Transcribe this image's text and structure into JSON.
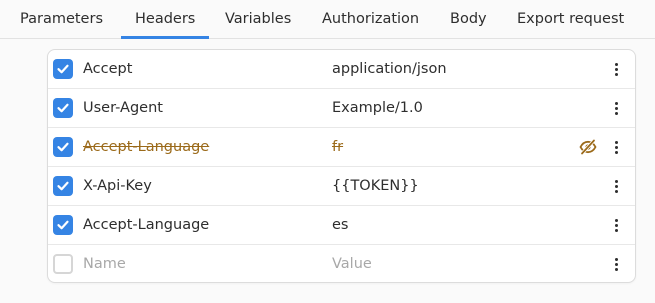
{
  "tabs": [
    {
      "label": "Parameters",
      "active": false
    },
    {
      "label": "Headers",
      "active": true
    },
    {
      "label": "Variables",
      "active": false
    },
    {
      "label": "Authorization",
      "active": false
    },
    {
      "label": "Body",
      "active": false
    },
    {
      "label": "Export request",
      "active": false
    }
  ],
  "colors": {
    "accent": "#3584e4",
    "disabled_text": "#9b6a1a",
    "placeholder": "#a8a8a8"
  },
  "headers": [
    {
      "enabled": true,
      "key": "Accept",
      "value": "application/json",
      "disabled_style": false
    },
    {
      "enabled": true,
      "key": "User-Agent",
      "value": "Example/1.0",
      "disabled_style": false
    },
    {
      "enabled": true,
      "key": "Accept-Language",
      "value": "fr",
      "disabled_style": true,
      "status_icon": "eye-slash-icon"
    },
    {
      "enabled": true,
      "key": "X-Api-Key",
      "value": "{{TOKEN}}",
      "disabled_style": false
    },
    {
      "enabled": true,
      "key": "Accept-Language",
      "value": "es",
      "disabled_style": false
    }
  ],
  "new_row": {
    "enabled": false,
    "key_placeholder": "Name",
    "value_placeholder": "Value"
  },
  "row_menu_icon": "vertical-ellipsis-icon"
}
